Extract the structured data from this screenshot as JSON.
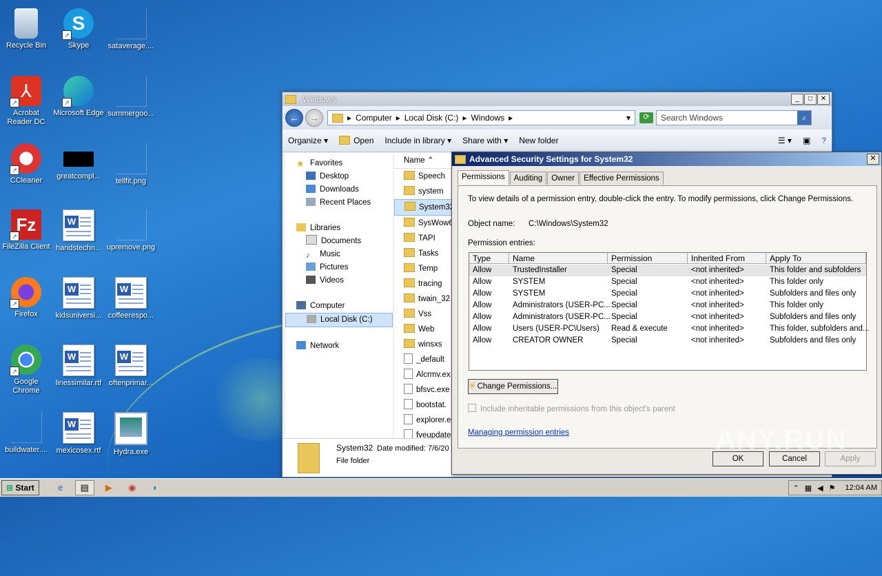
{
  "desktop": {
    "icons": [
      {
        "label": "Recycle Bin"
      },
      {
        "label": "Skype"
      },
      {
        "label": "sataverage...."
      },
      {
        "label": "Acrobat Reader DC"
      },
      {
        "label": "Microsoft Edge"
      },
      {
        "label": "summergoo..."
      },
      {
        "label": "CCleaner"
      },
      {
        "label": "greatcompl..."
      },
      {
        "label": "tellfit.png"
      },
      {
        "label": "FileZilla Client"
      },
      {
        "label": "handstechn..."
      },
      {
        "label": "upremove.png"
      },
      {
        "label": "Firefox"
      },
      {
        "label": "kidsuniversi..."
      },
      {
        "label": "coffeerespo..."
      },
      {
        "label": "Google Chrome"
      },
      {
        "label": "linessimilar.rtf"
      },
      {
        "label": "oftenprimar..."
      },
      {
        "label": "buildwater...."
      },
      {
        "label": "mexicosex.rtf"
      },
      {
        "label": "Hydra.exe"
      }
    ],
    "watermark": "ANY.RUN"
  },
  "explorer": {
    "title": "Windows",
    "address": [
      "Computer",
      "Local Disk (C:)",
      "Windows"
    ],
    "search_placeholder": "Search Windows",
    "commands": [
      "Organize",
      "Open",
      "Include in library",
      "Share with",
      "New folder"
    ],
    "nav": {
      "favorites": "Favorites",
      "favorites_items": [
        "Desktop",
        "Downloads",
        "Recent Places"
      ],
      "libraries": "Libraries",
      "libraries_items": [
        "Documents",
        "Music",
        "Pictures",
        "Videos"
      ],
      "computer": "Computer",
      "computer_items": [
        "Local Disk (C:)"
      ],
      "network": "Network"
    },
    "column_header": "Name",
    "files": [
      "Speech",
      "system",
      "System32",
      "SysWow6",
      "TAPI",
      "Tasks",
      "Temp",
      "tracing",
      "twain_32",
      "Vss",
      "Web",
      "winsxs",
      "_default",
      "Alcrmv.ex",
      "bfsvc.exe",
      "bootstat.",
      "explorer.e",
      "fveupdate"
    ],
    "details": {
      "name": "System32",
      "modified": "Date modified: 7/6/20",
      "type": "File folder"
    }
  },
  "dialog": {
    "title": "Advanced Security Settings for System32",
    "tabs": [
      "Permissions",
      "Auditing",
      "Owner",
      "Effective Permissions"
    ],
    "instructions": "To view details of a permission entry, double-click the entry. To modify permissions, click Change Permissions.",
    "object_label": "Object name:",
    "object_value": "C:\\Windows\\System32",
    "entries_label": "Permission entries:",
    "columns": [
      "Type",
      "Name",
      "Permission",
      "Inherited From",
      "Apply To"
    ],
    "rows": [
      {
        "type": "Allow",
        "name": "TrustedInstaller",
        "permission": "Special",
        "inherited": "<not inherited>",
        "apply": "This folder and subfolders"
      },
      {
        "type": "Allow",
        "name": "SYSTEM",
        "permission": "Special",
        "inherited": "<not inherited>",
        "apply": "This folder only"
      },
      {
        "type": "Allow",
        "name": "SYSTEM",
        "permission": "Special",
        "inherited": "<not inherited>",
        "apply": "Subfolders and files only"
      },
      {
        "type": "Allow",
        "name": "Administrators (USER-PC...",
        "permission": "Special",
        "inherited": "<not inherited>",
        "apply": "This folder only"
      },
      {
        "type": "Allow",
        "name": "Administrators (USER-PC...",
        "permission": "Special",
        "inherited": "<not inherited>",
        "apply": "Subfolders and files only"
      },
      {
        "type": "Allow",
        "name": "Users (USER-PC\\Users)",
        "permission": "Read & execute",
        "inherited": "<not inherited>",
        "apply": "This folder, subfolders and..."
      },
      {
        "type": "Allow",
        "name": "CREATOR OWNER",
        "permission": "Special",
        "inherited": "<not inherited>",
        "apply": "Subfolders and files only"
      }
    ],
    "change_button": "Change Permissions...",
    "checkbox_label": "Include inheritable permissions from this object's parent",
    "link": "Managing permission entries",
    "ok": "OK",
    "cancel": "Cancel",
    "apply": "Apply"
  },
  "taskbar": {
    "start": "Start",
    "clock": "12:04 AM"
  }
}
